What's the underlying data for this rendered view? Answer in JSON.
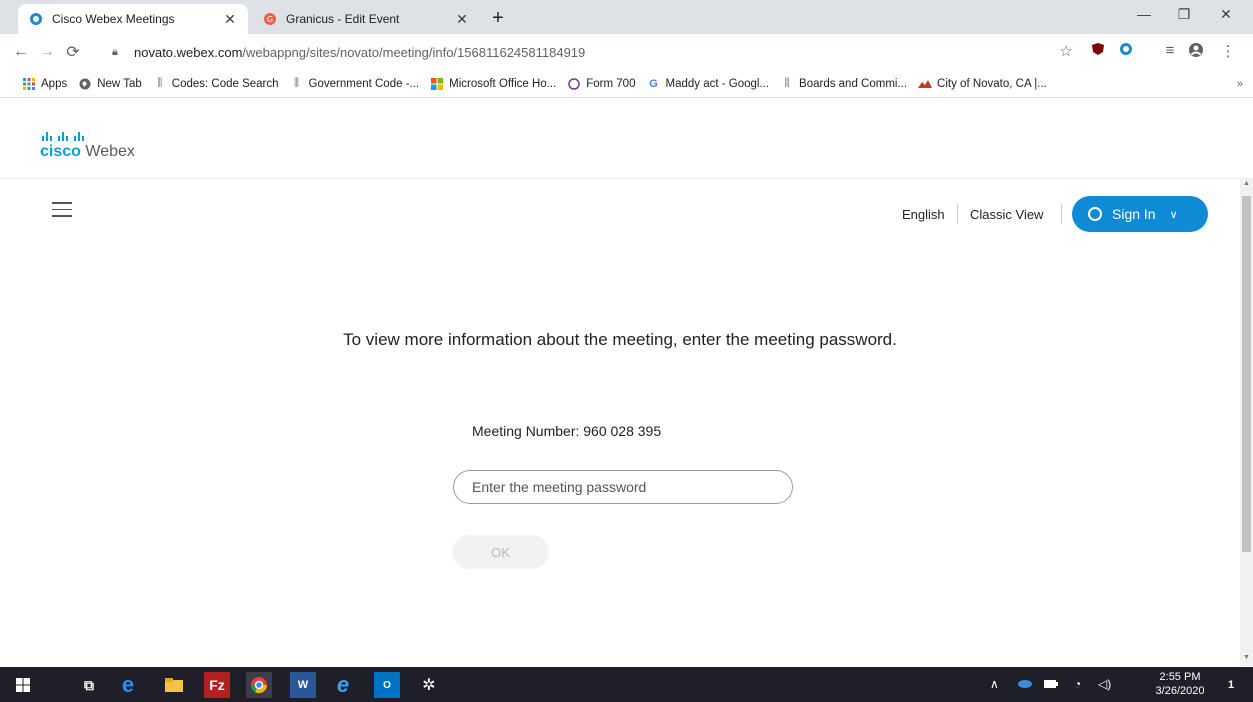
{
  "browser": {
    "tabs": [
      {
        "title": "Cisco Webex Meetings",
        "close": "✕",
        "active": true
      },
      {
        "title": "Granicus - Edit Event",
        "close": "✕",
        "active": false
      }
    ],
    "new_tab": "+",
    "window_controls": {
      "minimize": "—",
      "restore": "❐",
      "close": "✕"
    },
    "url_host": "novato.webex.com",
    "url_path": "/webappng/sites/novato/meeting/info/156811624581184919",
    "bookmarks": [
      "Apps",
      "New Tab",
      "Codes: Code Search",
      "Government Code -...",
      "Microsoft Office Ho...",
      "Form 700",
      "Maddy act - Googl...",
      "Boards and Commi...",
      "City of Novato, CA |..."
    ],
    "bookmarks_more": "»"
  },
  "header": {
    "logo_cisco": "cisco",
    "logo_webex": "Webex"
  },
  "nav": {
    "language": "English",
    "classic_view": "Classic View",
    "sign_in": "Sign In"
  },
  "main": {
    "prompt": "To view more information about the meeting, enter the meeting password.",
    "meeting_number": "Meeting Number: 960 028 395",
    "password_placeholder": "Enter the meeting password",
    "password_value": "",
    "ok_label": "OK"
  },
  "taskbar": {
    "time": "2:55 PM",
    "date": "3/26/2020",
    "notification_count": "1"
  },
  "colors": {
    "accent": "#0f8bd6",
    "cisco_blue": "#049fd9",
    "taskbar": "#1f1f2a"
  }
}
